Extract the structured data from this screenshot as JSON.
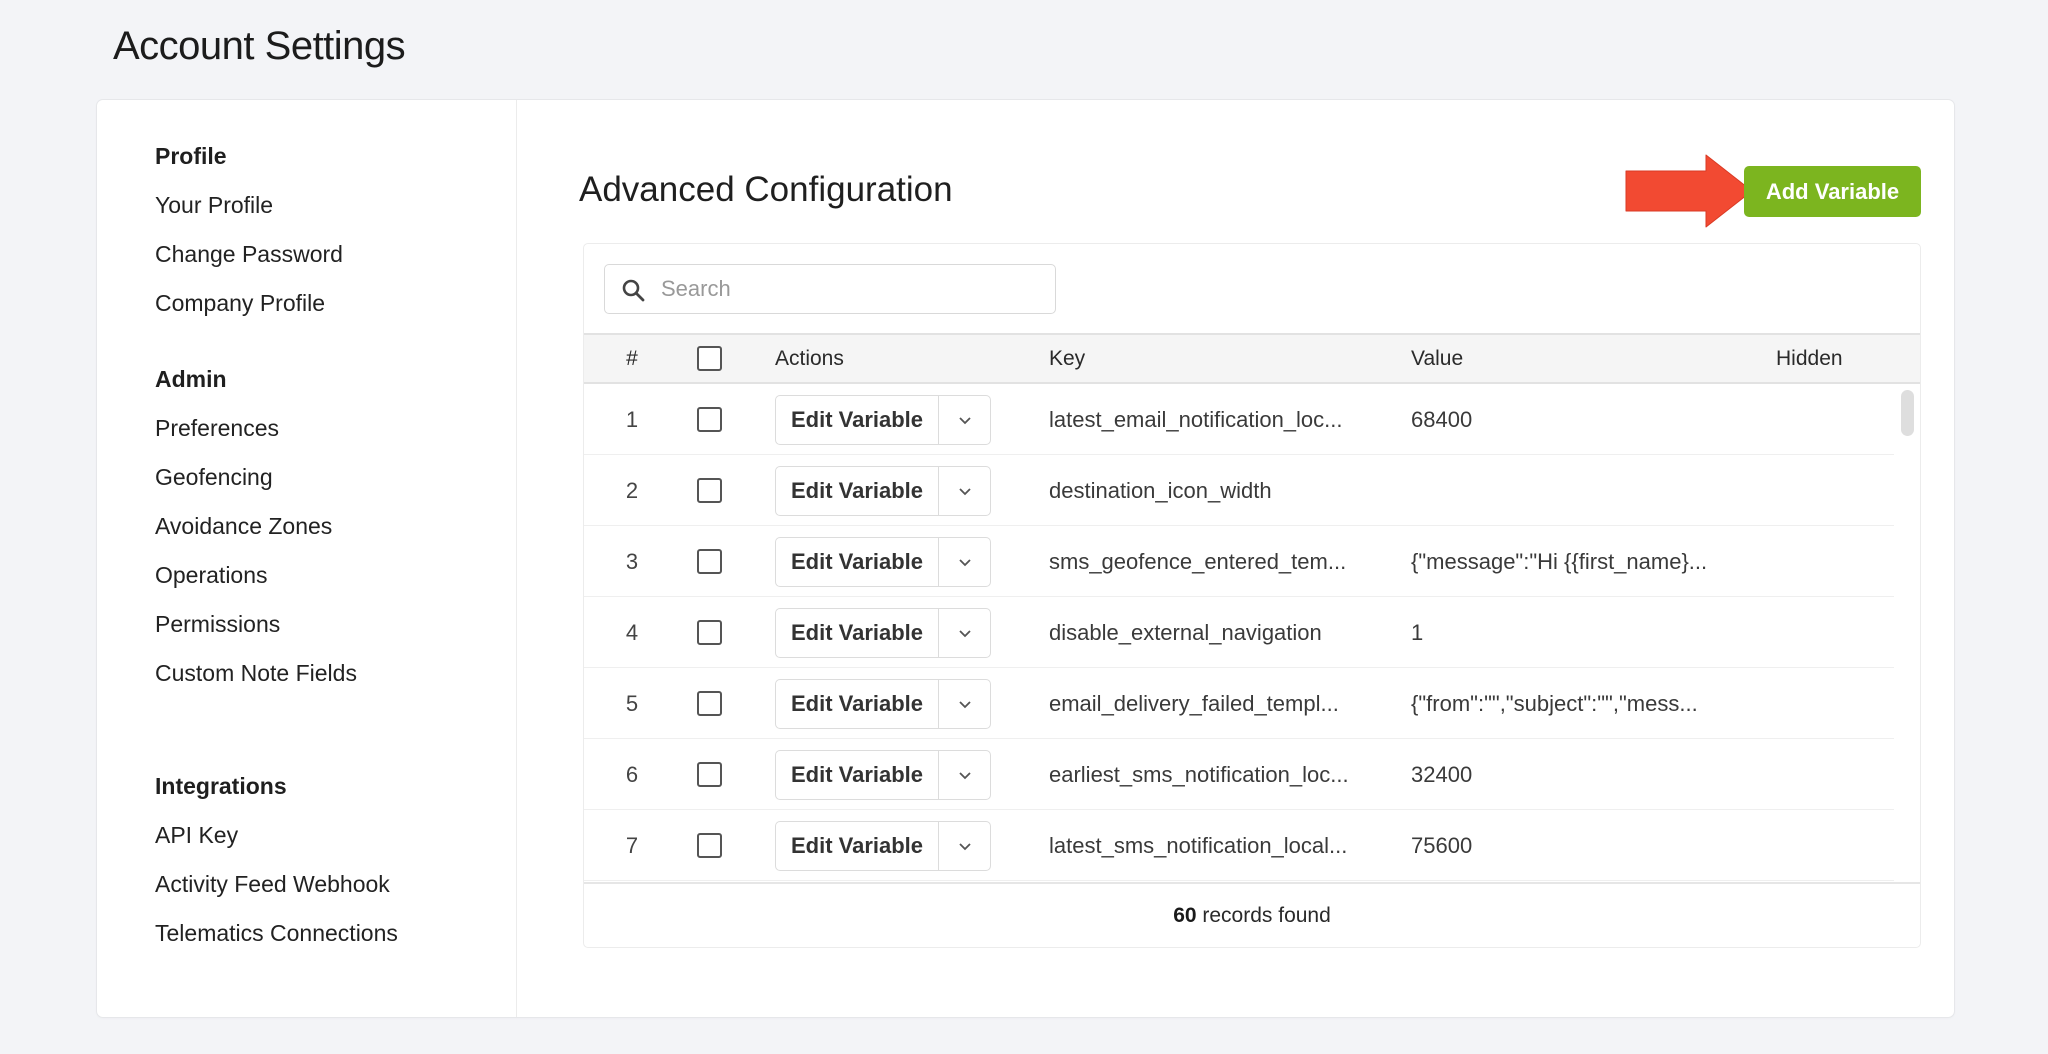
{
  "page": {
    "title": "Account Settings"
  },
  "sidebar": {
    "groups": [
      {
        "heading": "Profile",
        "items": [
          "Your Profile",
          "Change Password",
          "Company Profile"
        ]
      },
      {
        "heading": "Admin",
        "items": [
          "Preferences",
          "Geofencing",
          "Avoidance Zones",
          "Operations",
          "Permissions",
          "Custom Note Fields"
        ]
      },
      {
        "heading": "Integrations",
        "items": [
          "API Key",
          "Activity Feed Webhook",
          "Telematics Connections"
        ]
      }
    ]
  },
  "main": {
    "title": "Advanced Configuration",
    "add_button": "Add Variable",
    "colors": {
      "accent_green": "#7cb51f",
      "annotation_arrow": "#f24a32"
    },
    "search": {
      "placeholder": "Search",
      "value": "",
      "icon": "search-icon"
    },
    "table": {
      "columns": [
        "#",
        "",
        "Actions",
        "Key",
        "Value",
        "Hidden"
      ],
      "rows": [
        {
          "num": "1",
          "action": "Edit Variable",
          "key": "latest_email_notification_loc...",
          "value": "68400",
          "hidden": ""
        },
        {
          "num": "2",
          "action": "Edit Variable",
          "key": "destination_icon_width",
          "value": "",
          "hidden": ""
        },
        {
          "num": "3",
          "action": "Edit Variable",
          "key": "sms_geofence_entered_tem...",
          "value": "{\"message\":\"Hi {{first_name}...",
          "hidden": ""
        },
        {
          "num": "4",
          "action": "Edit Variable",
          "key": "disable_external_navigation",
          "value": "1",
          "hidden": ""
        },
        {
          "num": "5",
          "action": "Edit Variable",
          "key": "email_delivery_failed_templ...",
          "value": "{\"from\":\"\",\"subject\":\"\",\"mess...",
          "hidden": ""
        },
        {
          "num": "6",
          "action": "Edit Variable",
          "key": "earliest_sms_notification_loc...",
          "value": "32400",
          "hidden": ""
        },
        {
          "num": "7",
          "action": "Edit Variable",
          "key": "latest_sms_notification_local...",
          "value": "75600",
          "hidden": ""
        }
      ],
      "footer": {
        "count": "60",
        "label": " records found"
      }
    }
  }
}
